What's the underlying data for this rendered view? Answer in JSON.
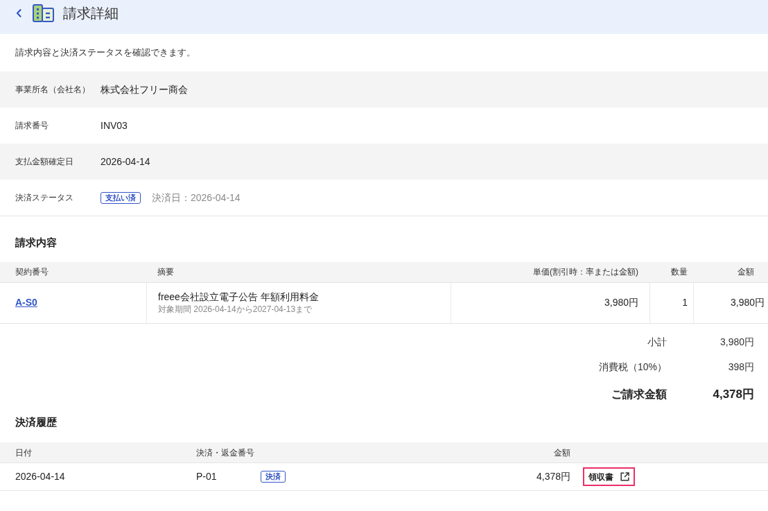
{
  "header": {
    "title": "請求詳細"
  },
  "description": "請求内容と決済ステータスを確認できます。",
  "details": [
    {
      "kind": "text",
      "label": "事業所名（会社名）",
      "value": "株式会社フリー商会"
    },
    {
      "kind": "text",
      "label": "請求番号",
      "value": "INV03"
    },
    {
      "kind": "text",
      "label": "支払金額確定日",
      "value": "2026-04-14"
    },
    {
      "kind": "status",
      "label": "決済ステータス",
      "badge": "支払い済",
      "note": "決済日：2026-04-14"
    }
  ],
  "invoice": {
    "heading": "請求内容",
    "columns": [
      "契約番号",
      "摘要",
      "単価(割引時：率または金額)",
      "数量",
      "金額"
    ],
    "rows": [
      {
        "contract_no": "A-S0",
        "item": "freee会社設立電子公告 年額利用料金",
        "period": "対象期間 2026-04-14から2027-04-13まで",
        "unit_price": "3,980円",
        "quantity": "1",
        "amount": "3,980円"
      }
    ],
    "summary": [
      {
        "kind": "normal",
        "label": "小計",
        "value": "3,980円"
      },
      {
        "kind": "normal",
        "label": "消費税（10%）",
        "value": "398円"
      },
      {
        "kind": "total",
        "label": "ご請求金額",
        "value": "4,378円"
      }
    ]
  },
  "payments": {
    "heading": "決済履歴",
    "columns": [
      "日付",
      "決済・返金番号",
      "金額"
    ],
    "rows": [
      {
        "date": "2026-04-14",
        "number": "P-01",
        "badge": "決済",
        "amount": "4,378円",
        "receipt": {
          "label": "領収書",
          "highlighted": true
        }
      }
    ]
  }
}
